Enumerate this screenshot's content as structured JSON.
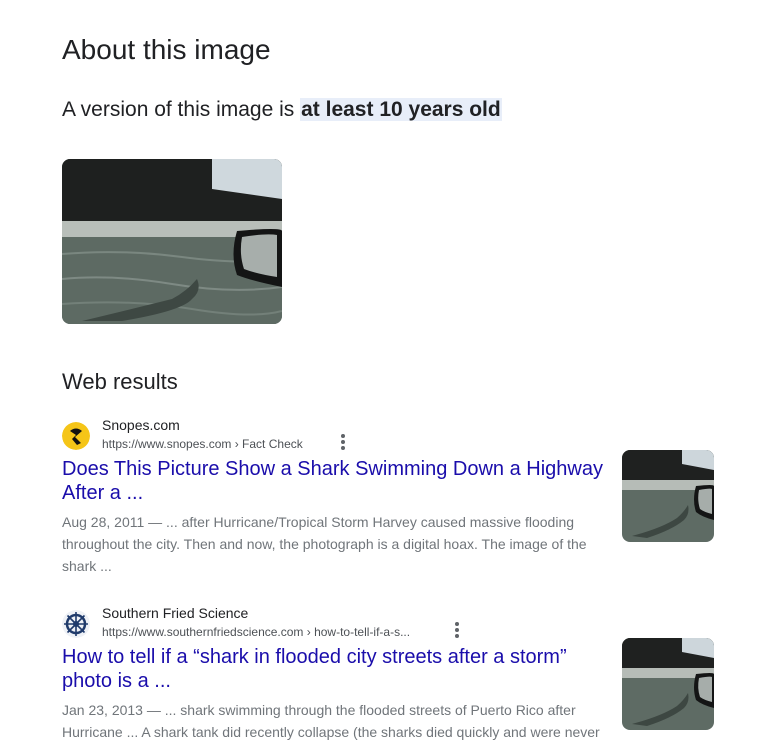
{
  "page": {
    "title": "About this image",
    "age_prefix": "A version of this image is ",
    "age_highlight": "at least 10 years old"
  },
  "web_results": {
    "heading": "Web results",
    "items": [
      {
        "source": "Snopes.com",
        "url": "https://www.snopes.com › Fact Check",
        "title": "Does This Picture Show a Shark Swimming Down a Highway After a ...",
        "date": "Aug 28, 2011",
        "snippet": " — ... after Hurricane/Tropical Storm Harvey caused massive flooding throughout the city. Then and now, the photograph is a digital hoax. The image of the shark ...",
        "favicon": "snopes-logo-icon",
        "favicon_color": "#f5c518"
      },
      {
        "source": "Southern Fried Science",
        "url": "https://www.southernfriedscience.com › how-to-tell-if-a-s...",
        "title": "How to tell if a “shark in flooded city streets after a storm” photo is a ...",
        "date": "Jan 23, 2013",
        "snippet": " — ... shark swimming through the flooded streets of Puerto Rico after Hurricane ... A shark tank did recently collapse (the sharks died quickly and were never",
        "favicon": "ship-wheel-icon",
        "favicon_color": "#1f3a6b"
      }
    ]
  },
  "colors": {
    "link": "#1a0dab",
    "highlight": "#e8eef9",
    "snippet": "#70757a"
  }
}
